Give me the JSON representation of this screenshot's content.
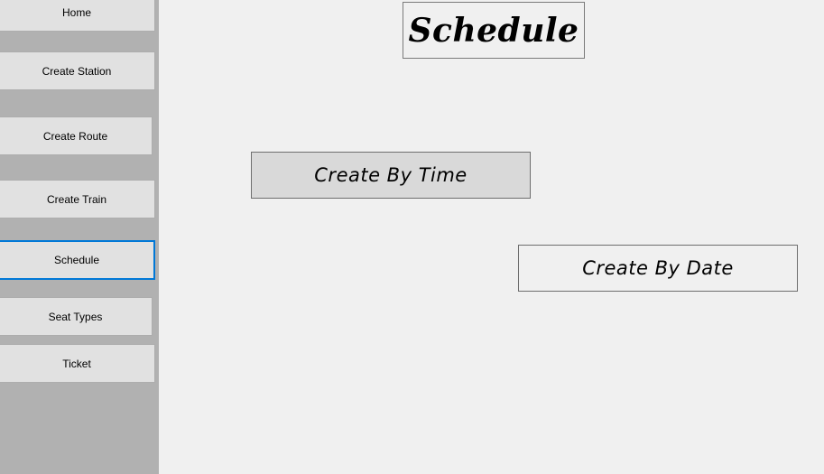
{
  "sidebar": {
    "items": [
      {
        "id": "home",
        "label": "Home"
      },
      {
        "id": "create-station",
        "label": "Create Station"
      },
      {
        "id": "create-route",
        "label": "Create Route"
      },
      {
        "id": "create-train",
        "label": "Create Train"
      },
      {
        "id": "schedule",
        "label": "Schedule",
        "active": true
      },
      {
        "id": "seat-types",
        "label": "Seat Types"
      },
      {
        "id": "ticket",
        "label": "Ticket"
      }
    ]
  },
  "main": {
    "title": "Schedule",
    "create_by_time_label": "Create By Time",
    "create_by_date_label": "Create By Date"
  },
  "colors": {
    "sidebar_bg": "#b1b1b1",
    "button_bg": "#e1e1e1",
    "content_bg": "#f0f0f0",
    "active_border": "#0078d7",
    "selected_button_bg": "#d9d9d9"
  }
}
